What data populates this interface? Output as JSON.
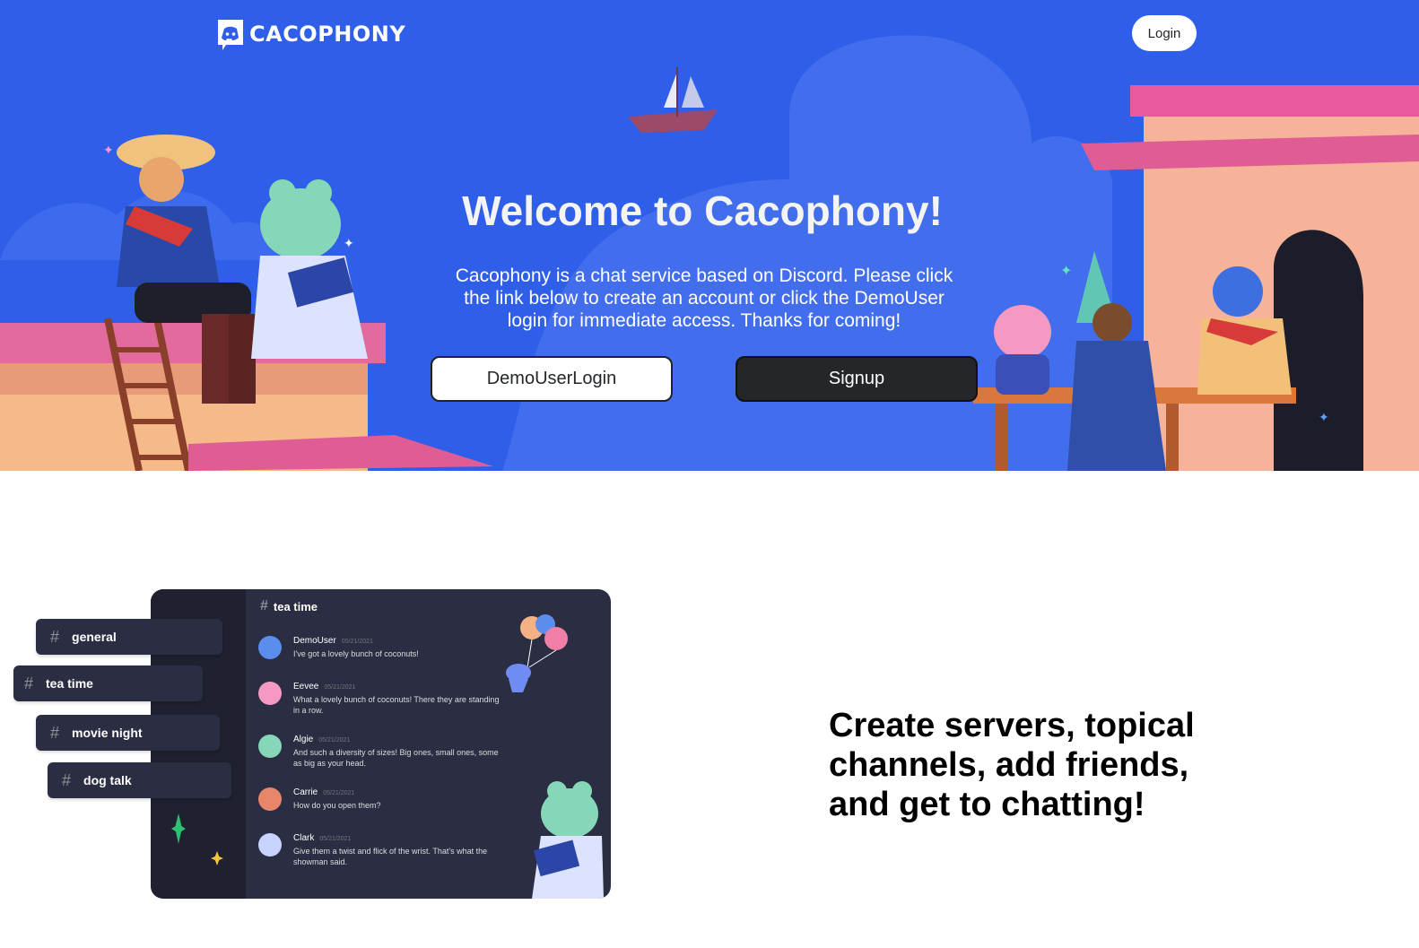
{
  "header": {
    "logo_text": "CACOPHONY",
    "login_label": "Login"
  },
  "hero": {
    "title": "Welcome to Cacophony!",
    "description": "Cacophony is a chat service based on Discord. Please click the link below to create an account or click the DemoUser login for immediate access. Thanks for coming!",
    "demo_button": "DemoUserLogin",
    "signup_button": "Signup"
  },
  "mockup": {
    "channel_title": "tea time",
    "channels": [
      {
        "label": "general"
      },
      {
        "label": "tea time"
      },
      {
        "label": "movie night"
      },
      {
        "label": "dog talk"
      }
    ],
    "messages": [
      {
        "name": "DemoUser",
        "date": "05/21/2021",
        "text": "I've got a lovely bunch of coconuts!"
      },
      {
        "name": "Eevee",
        "date": "05/21/2021",
        "text": "What a lovely bunch of coconuts! There they are standing in a row."
      },
      {
        "name": "Algie",
        "date": "05/21/2021",
        "text": "And such a diversity of sizes! Big ones, small ones, some as big as your head."
      },
      {
        "name": "Carrie",
        "date": "05/21/2021",
        "text": "How do you open them?"
      },
      {
        "name": "Clark",
        "date": "05/21/2021",
        "text": "Give them a twist and flick of the wrist. That's what the showman said."
      }
    ]
  },
  "feature": {
    "headline": "Create servers, topical channels, add friends, and get to chatting!"
  },
  "colors": {
    "hero_blue": "#2f5ee8",
    "dark_button": "#23272a",
    "mock_panel": "#2b2d42"
  }
}
